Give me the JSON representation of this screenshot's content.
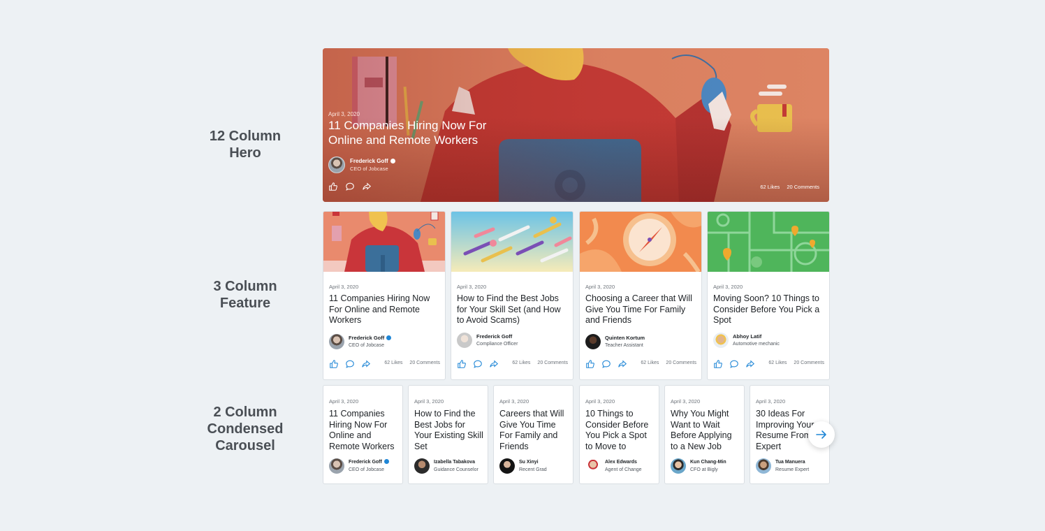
{
  "labels": {
    "hero": [
      "12 Column",
      "Hero"
    ],
    "feature": [
      "3 Column",
      "Feature"
    ],
    "carousel": [
      "2 Column",
      "Condensed",
      "Carousel"
    ]
  },
  "hero": {
    "date": "April 3, 2020",
    "title": "11 Companies Hiring Now For Online and Remote Workers",
    "author": {
      "name": "Frederick Goff",
      "role": "CEO of Jobcase",
      "verified": true
    },
    "likes": "62 Likes",
    "comments": "20 Comments"
  },
  "feature": [
    {
      "date": "April 3, 2020",
      "title": "11 Companies Hiring Now For Online and Remote Workers",
      "author": {
        "name": "Frederick Goff",
        "role": "CEO of Jobcase",
        "verified": true
      },
      "likes": "62 Likes",
      "comments": "20 Comments",
      "thumb": "person-at-desk-illustration"
    },
    {
      "date": "April 3, 2020",
      "title": "How to Find the Best Jobs for Your Skill Set (and How to Avoid Scams)",
      "author": {
        "name": "Frederick Goff",
        "role": "Compliance Officer",
        "verified": false
      },
      "likes": "62 Likes",
      "comments": "20 Comments",
      "thumb": "flying-pills-illustration"
    },
    {
      "date": "April 3, 2020",
      "title": "Choosing a Career that Will Give You Time For Family and Friends",
      "author": {
        "name": "Quinten Kortum",
        "role": "Teacher Assistant",
        "verified": false
      },
      "likes": "62 Likes",
      "comments": "20 Comments",
      "thumb": "compass-illustration"
    },
    {
      "date": "April 3, 2020",
      "title": "Moving Soon? 10 Things to Consider Before You Pick a Spot",
      "author": {
        "name": "Abhoy Latif",
        "role": "Automotive mechanic",
        "verified": false
      },
      "likes": "62 Likes",
      "comments": "20 Comments",
      "thumb": "map-illustration"
    }
  ],
  "carousel": [
    {
      "date": "April 3, 2020",
      "title": "11 Companies Hiring Now For Online and Remote Workers",
      "author": {
        "name": "Frederick Goff",
        "role": "CEO of Jobcase",
        "verified": true
      }
    },
    {
      "date": "April 3, 2020",
      "title": "How to Find the Best Jobs for Your Existing Skill Set",
      "author": {
        "name": "Izabella Tabakova",
        "role": "Guidance Counselor",
        "verified": false
      }
    },
    {
      "date": "April 3, 2020",
      "title": "Careers that Will Give You Time For Family and Friends",
      "author": {
        "name": "Su Xinyi",
        "role": "Recent Grad",
        "verified": false
      }
    },
    {
      "date": "April 3, 2020",
      "title": "10 Things to Consider Before You Pick a Spot to Move to",
      "author": {
        "name": "Alex Edwards",
        "role": "Agent of Change",
        "verified": false
      }
    },
    {
      "date": "April 3, 2020",
      "title": "Why You Might Want to Wait Before Applying to a New Job",
      "author": {
        "name": "Kun Chang-Min",
        "role": "CFO at Bigly",
        "verified": false
      }
    },
    {
      "date": "April 3, 2020",
      "title": "30 Ideas For Improving Your Resume From an Expert",
      "author": {
        "name": "Tua Manuera",
        "role": "Resume Expert",
        "verified": false
      }
    }
  ],
  "icons": {
    "like": "thumbs-up-icon",
    "comment": "comment-icon",
    "share": "share-icon",
    "next": "arrow-right-icon",
    "verified": "verified-badge-icon"
  },
  "colors": {
    "background": "#edf1f4",
    "accent": "#1f86d6",
    "hero": "#d97a5d"
  }
}
